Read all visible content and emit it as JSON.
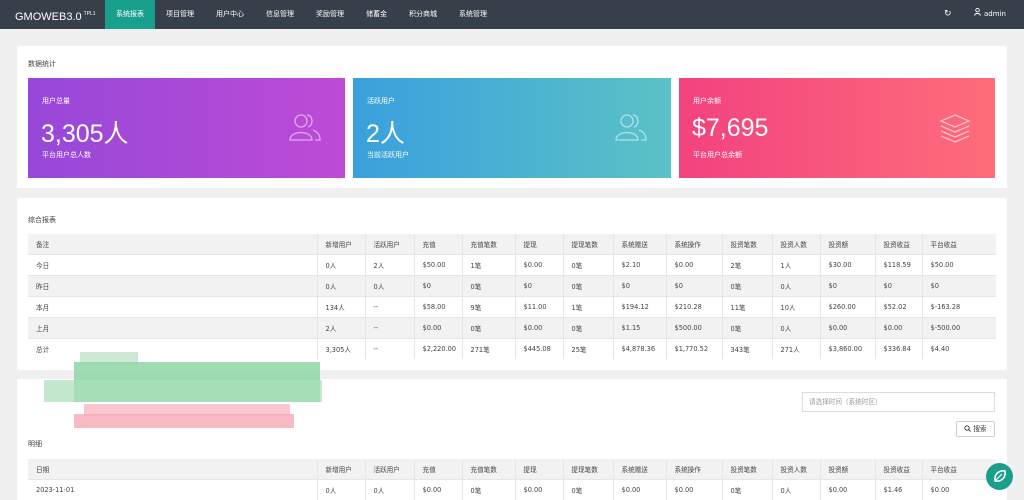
{
  "app": {
    "brand": "GMOWEB3.0",
    "version": "TPL1",
    "user": "admin"
  },
  "nav": [
    "系统报表",
    "项目管理",
    "用户中心",
    "信息管理",
    "奖励管理",
    "储蓄金",
    "积分商城",
    "系统管理"
  ],
  "stats": {
    "title": "数据统计",
    "cards": [
      {
        "label": "用户总量",
        "value": "3,305人",
        "sub": "平台用户总人数",
        "icon": "users-icon"
      },
      {
        "label": "活跃用户",
        "value": "2人",
        "sub": "当前活跃用户",
        "icon": "users-icon"
      },
      {
        "label": "用户余额",
        "value": "$7,695",
        "sub": "平台用户总余额",
        "icon": "layers-icon"
      }
    ]
  },
  "report": {
    "title": "综合报表",
    "headers": [
      "备注",
      "新增用户",
      "活跃用户",
      "充值",
      "充值笔数",
      "提现",
      "提现笔数",
      "系统赠送",
      "系统操作",
      "投资笔数",
      "投资人数",
      "投资额",
      "投资收益",
      "平台收益"
    ],
    "rows": [
      [
        "今日",
        "0人",
        "2人",
        "$50.00",
        "1笔",
        "$0.00",
        "0笔",
        "$2.10",
        "$0.00",
        "2笔",
        "1人",
        "$30.00",
        "$118.59",
        "$50.00"
      ],
      [
        "昨日",
        "0人",
        "0人",
        "$0",
        "0笔",
        "$0",
        "0笔",
        "$0",
        "$0",
        "0笔",
        "0人",
        "$0",
        "$0",
        "$0"
      ],
      [
        "本月",
        "134人",
        "--",
        "$58.00",
        "9笔",
        "$11.00",
        "1笔",
        "$194.12",
        "$210.28",
        "11笔",
        "10人",
        "$260.00",
        "$52.02",
        "$-163.28"
      ],
      [
        "上月",
        "2人",
        "--",
        "$0.00",
        "0笔",
        "$0.00",
        "0笔",
        "$1.15",
        "$500.00",
        "0笔",
        "0人",
        "$0.00",
        "$0.00",
        "$-500.00"
      ],
      [
        "总计",
        "3,305人",
        "--",
        "$2,220.00",
        "271笔",
        "$445.08",
        "25笔",
        "$4,878.36",
        "$1,770.52",
        "343笔",
        "271人",
        "$3,860.00",
        "$336.84",
        "$4.40"
      ]
    ]
  },
  "detail": {
    "date_placeholder": "请选择时间（系统时区）",
    "search_label": "搜索",
    "title": "明细",
    "headers": [
      "日期",
      "新增用户",
      "活跃用户",
      "充值",
      "充值笔数",
      "提现",
      "提现笔数",
      "系统赠送",
      "系统操作",
      "投资笔数",
      "投资人数",
      "投资额",
      "投资收益",
      "平台收益"
    ],
    "rows": [
      [
        "2023-11-01",
        "0人",
        "0人",
        "$0.00",
        "0笔",
        "$0.00",
        "0笔",
        "$0.00",
        "$0.00",
        "0笔",
        "0人",
        "$0.00",
        "$1.46",
        "$0.00"
      ]
    ]
  }
}
